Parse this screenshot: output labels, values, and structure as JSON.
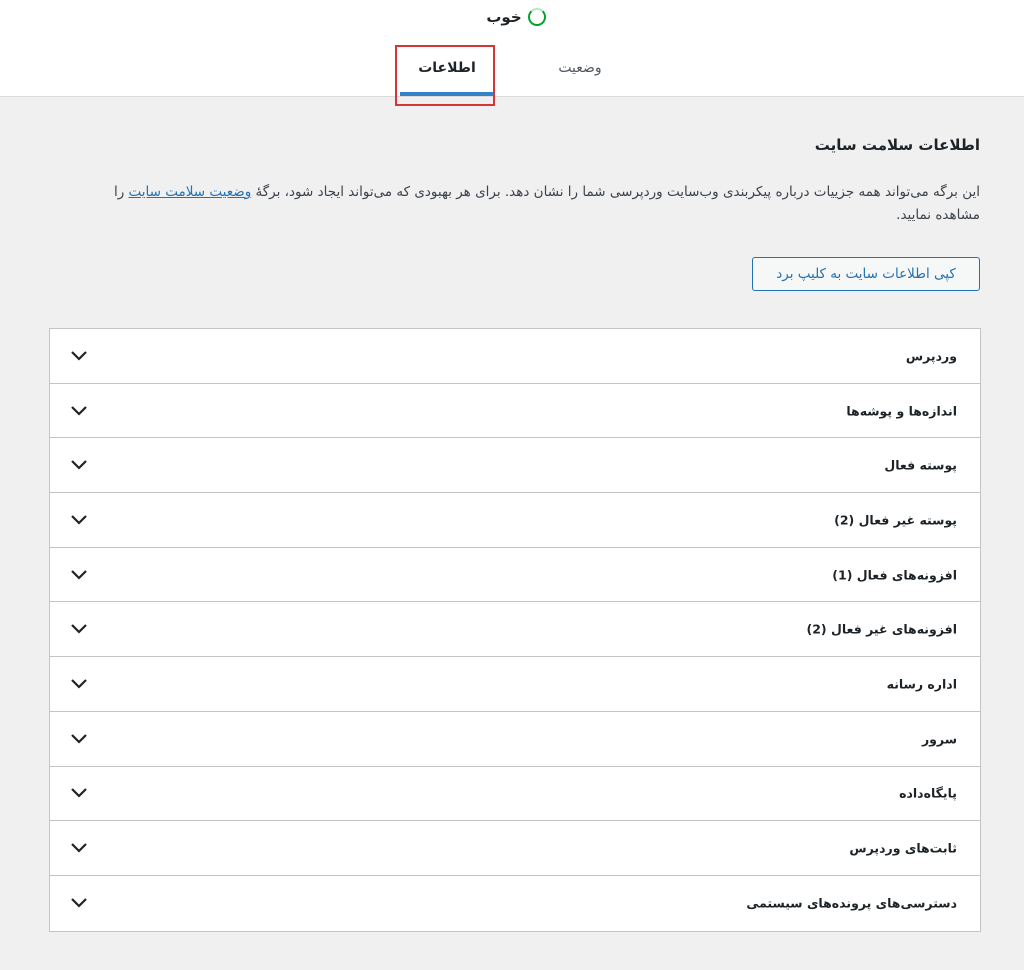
{
  "status": {
    "label": "خوب",
    "color": "#00a32a"
  },
  "tabs": [
    {
      "label": "اطلاعات",
      "active": true
    },
    {
      "label": "وضعیت",
      "active": false
    }
  ],
  "main": {
    "title": "اطلاعات سلامت سایت",
    "description_text": "این برگه می‌تواند همه جزییات درباره پیکربندی وب‌سایت وردپرسی شما را نشان دهد. برای هر بهبودی که می‌تواند ایجاد شود، برگهٔ ",
    "description_link": "وضعیت سلامت سایت",
    "description_suffix": " را مشاهده نمایید.",
    "copy_button": "کپی اطلاعات سایت به کلیپ برد"
  },
  "accordion": {
    "items": [
      {
        "label": "وردپرس"
      },
      {
        "label": "اندازه‌ها و پوشه‌ها"
      },
      {
        "label": "پوسته فعال"
      },
      {
        "label": "پوسته غیر فعال (2)"
      },
      {
        "label": "افزونه‌های فعال (1)"
      },
      {
        "label": "افزونه‌های غیر فعال (2)"
      },
      {
        "label": "اداره رسانه"
      },
      {
        "label": "سرور"
      },
      {
        "label": "پایگاه‌داده"
      },
      {
        "label": "ثابت‌های وردپرس"
      },
      {
        "label": "دسترسی‌های پرونده‌های سیستمی"
      }
    ]
  },
  "colors": {
    "accent": "#2271b1",
    "tab_underline": "#3582c4",
    "highlight": "#d63638"
  }
}
